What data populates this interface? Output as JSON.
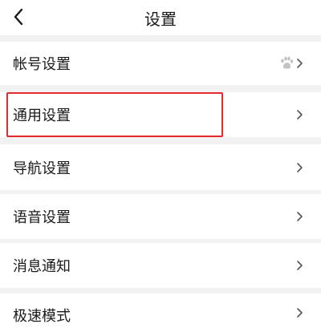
{
  "header": {
    "title": "设置",
    "back_icon": "chevron-left-icon"
  },
  "settings": {
    "items": [
      {
        "label": "帐号设置",
        "icon": "paw-icon"
      },
      {
        "label": "通用设置",
        "highlighted": true
      },
      {
        "label": "导航设置"
      },
      {
        "label": "语音设置"
      },
      {
        "label": "消息通知"
      },
      {
        "label": "极速模式"
      }
    ]
  },
  "colors": {
    "background": "#ffffff",
    "separator": "#f2f2f2",
    "text": "#1a1a1a",
    "chevron": "#555555",
    "highlight": "#e8282d"
  }
}
